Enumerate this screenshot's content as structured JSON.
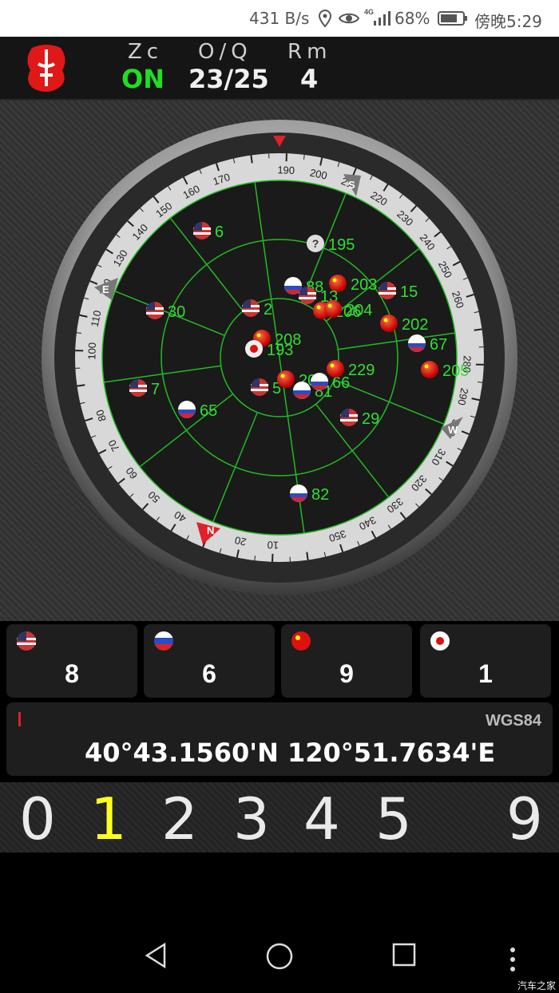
{
  "status_bar": {
    "speed": "431 B/s",
    "network": "4G",
    "battery": "68%",
    "time": "傍晚5:29"
  },
  "header": {
    "zc_label": "Zc",
    "zc_value": "ON",
    "oq_label": "O/Q",
    "oq_value": "23/25",
    "rm_label": "Rm",
    "rm_value": "4",
    "on_color": "#22dd22"
  },
  "compass": {
    "direction_N": "N",
    "direction_E": "E",
    "direction_S": "S",
    "direction_W": "W",
    "degree_labels": [
      "10",
      "20",
      "30",
      "40",
      "50",
      "60",
      "70",
      "80",
      "100",
      "110",
      "120",
      "130",
      "140",
      "150",
      "160",
      "170",
      "190",
      "200",
      "210",
      "220",
      "230",
      "240",
      "250",
      "260",
      "280",
      "290",
      "300",
      "310",
      "320",
      "330",
      "340",
      "350"
    ],
    "accent": "#e0202a",
    "grid_color": "#22bb22"
  },
  "satellites": [
    {
      "label": "6",
      "flag": "us"
    },
    {
      "label": "195",
      "flag": "unknown"
    },
    {
      "label": "88",
      "flag": "ru"
    },
    {
      "label": "203",
      "flag": "cn"
    },
    {
      "label": "15",
      "flag": "us"
    },
    {
      "label": "13",
      "flag": "us"
    },
    {
      "label": "30",
      "flag": "us"
    },
    {
      "label": "2",
      "flag": "us"
    },
    {
      "label": "206",
      "flag": "cn"
    },
    {
      "label": "204",
      "flag": "cn"
    },
    {
      "label": "202",
      "flag": "cn"
    },
    {
      "label": "67",
      "flag": "ru"
    },
    {
      "label": "208",
      "flag": "cn"
    },
    {
      "label": "193",
      "flag": "jp"
    },
    {
      "label": "7",
      "flag": "us"
    },
    {
      "label": "5",
      "flag": "us"
    },
    {
      "label": "209",
      "flag": "cn"
    },
    {
      "label": "81",
      "flag": "ru"
    },
    {
      "label": "66",
      "flag": "ru"
    },
    {
      "label": "229",
      "flag": "cn"
    },
    {
      "label": "205",
      "flag": "cn"
    },
    {
      "label": "65",
      "flag": "ru"
    },
    {
      "label": "29",
      "flag": "us"
    },
    {
      "label": "82",
      "flag": "ru"
    }
  ],
  "constellation_counts": [
    {
      "flag": "us",
      "count": "8"
    },
    {
      "flag": "ru",
      "count": "6"
    },
    {
      "flag": "cn",
      "count": "9"
    },
    {
      "flag": "jp",
      "count": "1"
    }
  ],
  "location": {
    "datum": "WGS84",
    "latitude": "40°43.1560'N",
    "longitude": "120°51.7634'E"
  },
  "digits": [
    {
      "value": "0",
      "color": "#eaeaea"
    },
    {
      "value": "1",
      "color": "#ffff22"
    },
    {
      "value": "2",
      "color": "#eaeaea"
    },
    {
      "value": "3",
      "color": "#eaeaea"
    },
    {
      "value": "4",
      "color": "#eaeaea"
    },
    {
      "value": "5",
      "color": "#eaeaea"
    },
    {
      "value": "9",
      "color": "#eaeaea"
    }
  ],
  "watermark": "汽车之家"
}
